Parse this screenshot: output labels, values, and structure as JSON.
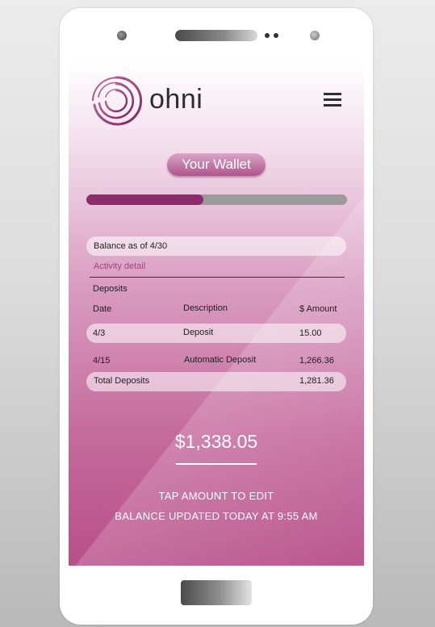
{
  "brand": {
    "name": "ohni"
  },
  "colors": {
    "accent": "#8c2c6c",
    "accent_light": "#a7407c",
    "screen_bottom": "#b84f8a",
    "track": "#9b9b9b"
  },
  "icons": {
    "logo": "swirl-logo-icon",
    "menu": "hamburger-menu-icon"
  },
  "wallet": {
    "button_label": "Your Wallet",
    "progress_fraction": 0.45
  },
  "statement": {
    "balance_label": "Balance as of 4/30",
    "activity_label": "Activity detail",
    "section_title": "Deposits",
    "columns": {
      "date": "Date",
      "description": "Description",
      "amount": "$ Amount"
    },
    "rows": [
      {
        "date": "4/3",
        "description": "Deposit",
        "amount": "15.00"
      },
      {
        "date": "4/15",
        "description": "Automatic Deposit",
        "amount": "1,266.36"
      }
    ],
    "total": {
      "label": "Total Deposits",
      "amount": "1,281.36"
    }
  },
  "balance": {
    "amount": "$1,338.05",
    "hint": "TAP AMOUNT TO EDIT",
    "updated": "BALANCE UPDATED TODAY AT 9:55 AM"
  }
}
